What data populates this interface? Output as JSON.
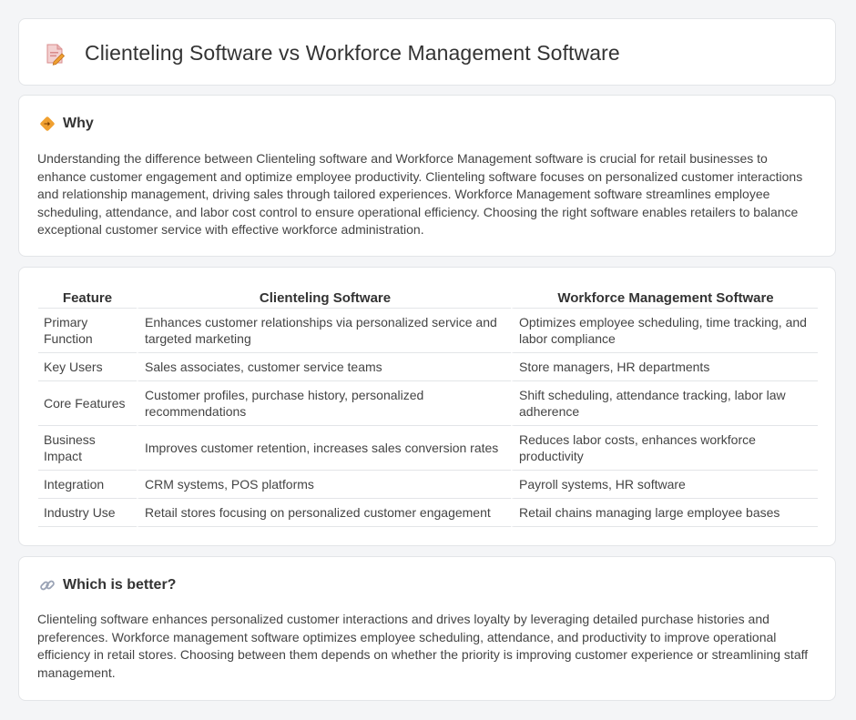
{
  "page": {
    "title": "Clienteling Software vs Workforce Management Software",
    "title_icon": "document-edit-icon"
  },
  "why": {
    "heading": "Why",
    "icon": "diamond-signpost-icon",
    "text": "Understanding the difference between Clienteling software and Workforce Management software is crucial for retail businesses to enhance customer engagement and optimize employee productivity. Clienteling software focuses on personalized customer interactions and relationship management, driving sales through tailored experiences. Workforce Management software streamlines employee scheduling, attendance, and labor cost control to ensure operational efficiency. Choosing the right software enables retailers to balance exceptional customer service with effective workforce administration."
  },
  "table": {
    "headers": [
      "Feature",
      "Clienteling Software",
      "Workforce Management Software"
    ],
    "rows": [
      [
        "Primary Function",
        "Enhances customer relationships via personalized service and targeted marketing",
        "Optimizes employee scheduling, time tracking, and labor compliance"
      ],
      [
        "Key Users",
        "Sales associates, customer service teams",
        "Store managers, HR departments"
      ],
      [
        "Core Features",
        "Customer profiles, purchase history, personalized recommendations",
        "Shift scheduling, attendance tracking, labor law adherence"
      ],
      [
        "Business Impact",
        "Improves customer retention, increases sales conversion rates",
        "Reduces labor costs, enhances workforce productivity"
      ],
      [
        "Integration",
        "CRM systems, POS platforms",
        "Payroll systems, HR software"
      ],
      [
        "Industry Use",
        "Retail stores focusing on personalized customer engagement",
        "Retail chains managing large employee bases"
      ]
    ]
  },
  "better": {
    "heading": "Which is better?",
    "icon": "link-icon",
    "text": "Clienteling software enhances personalized customer interactions and drives loyalty by leveraging detailed purchase histories and preferences. Workforce management software optimizes employee scheduling, attendance, and productivity to improve operational efficiency in retail stores. Choosing between them depends on whether the priority is improving customer experience or streamlining staff management."
  },
  "colors": {
    "background": "#f4f5f7",
    "card": "#ffffff",
    "border": "#e3e5e8",
    "text": "#444444",
    "icon_orange": "#f0a030"
  }
}
